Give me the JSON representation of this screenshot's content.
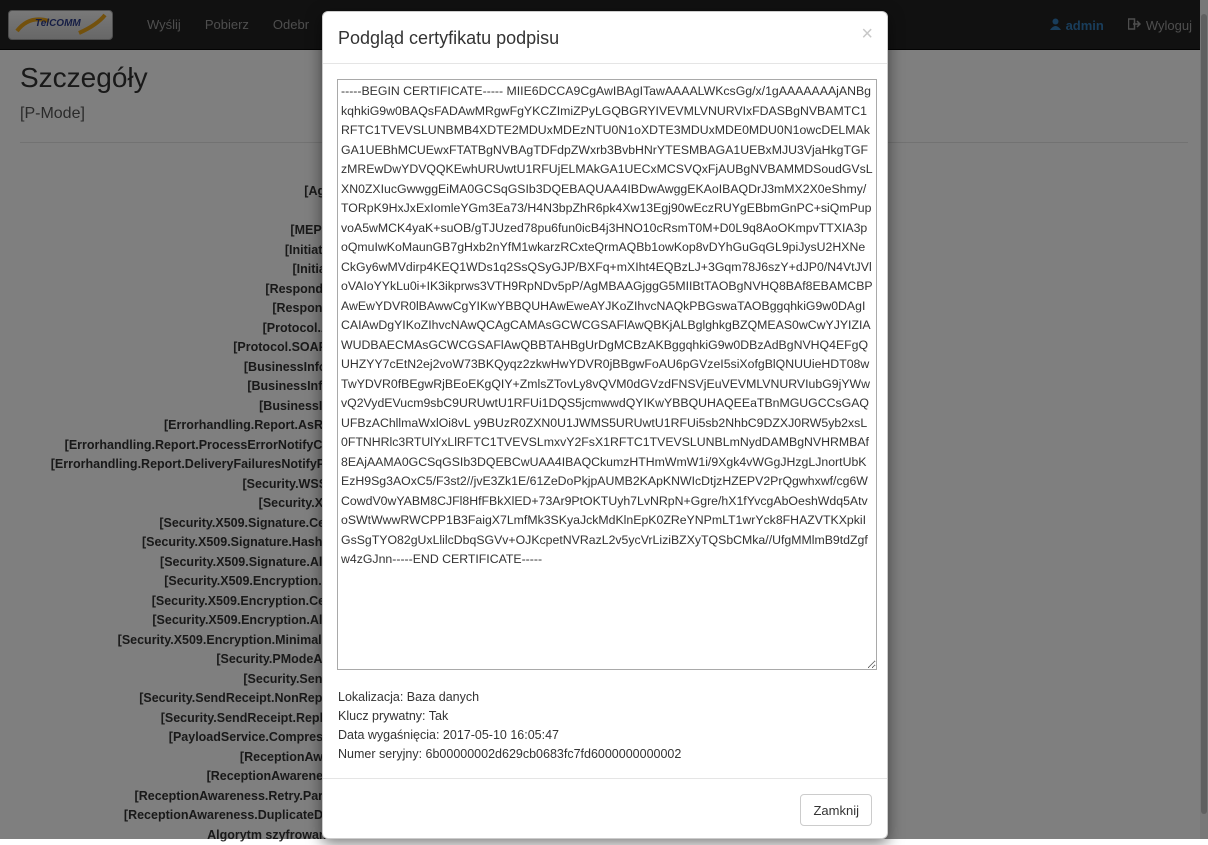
{
  "navbar": {
    "logo_text": "TelCOMM",
    "items": [
      "Wyślij",
      "Pobierz",
      "Odebr"
    ],
    "user": "admin",
    "logout": "Wyloguj"
  },
  "page": {
    "title": "Szczegóły",
    "subtitle": "[P-Mode]",
    "params": [
      "[Agr",
      "",
      "[MEPE",
      "[Initiato",
      "[Initiat",
      "[Responde",
      "[Respond",
      "[Protocol.A",
      "[Protocol.SOAP'",
      "[BusinessInfo.",
      "[BusinessInfo",
      "[BusinessIn",
      "[Errorhandling.Report.AsRe",
      "[Errorhandling.Report.ProcessErrorNotifyCo",
      "[Errorhandling.Report.DeliveryFailuresNotifyPr",
      "[Security.WSS'",
      "[Security.X5",
      "[Security.X509.Signature.Cer",
      "[Security.X509.Signature.HashF",
      "[Security.X509.Signature.Alg",
      "[Security.X509.Encryption.E",
      "[Security.X509.Encryption.Cer",
      "[Security.X509.Encryption.Alg",
      "[Security.X509.Encryption.MinimalS",
      "[Security.PModeAu",
      "[Security.Send",
      "[Security.SendReceipt.NonRepu",
      "[Security.SendReceipt.Reply",
      "[PayloadService.Compress",
      "[ReceptionAwa",
      "[ReceptionAwarenes",
      "[ReceptionAwareness.Retry.Para",
      "[ReceptionAwareness.DuplicateDe",
      "Algorytm szyfrowani"
    ]
  },
  "modal": {
    "title": "Podgląd certyfikatu podpisu",
    "close_symbol": "×",
    "certificate": "-----BEGIN CERTIFICATE----- MIIE6DCCA9CgAwIBAgITawAAAALWKcsGg/x/1gAAAAAAAjANBgkqhkiG9w0BAQsFADAwMRgwFgYKCZImiZPyLGQBGRYIVEVMLVNURVIxFDASBgNVBAMTC1RFTC1TVEVSLUNBMB4XDTE2MDUxMDEzNTU0N1oXDTE3MDUxMDE0MDU0N1owcDELMAkGA1UEBhMCUEwxFTATBgNVBAgTDFdpZWxrb3BvbHNrYTESMBAGA1UEBxMJU3VjaHkgTGFzMREwDwYDVQQKEwhURUwtU1RFUjELMAkGA1UECxMCSVQxFjAUBgNVBAMMDSoudGVsLXN0ZXIucGwwggEiMA0GCSqGSIb3DQEBAQUAA4IBDwAwggEKAoIBAQDrJ3mMX2X0eShmy/TORpK9HxJxExIomleYGm3Ea73/H4N3bpZhR6pk4Xw13Egj90wEczRUYgEBbmGnPC+siQmPupvoA5wMCK4yaK+suOB/gTJUzed78pu6fun0icB4j3HNO10cRsmT0M+D0L9q8AoOKmpvTTXIA3poQmuIwKoMaunGB7gHxb2nYfM1wkarzRCxteQrmAQBb1owKop8vDYhGuGqGL9piJysU2HXNeCkGy6wMVdirp4KEQ1WDs1q2SsQSyGJP/BXFq+mXIht4EQBzLJ+3Gqm78J6szY+dJP0/N4VtJVloVAIoYYkLu0i+IK3ikprws3VTH9RpNDv5pP/AgMBAAGjggG5MIIBtTAOBgNVHQ8BAf8EBAMCBPAwEwYDVR0lBAwwCgYIKwYBBQUHAwEweAYJKoZIhvcNAQkPBGswaTAOBggqhkiG9w0DAgICAIAwDgYIKoZIhvcNAwQCAgCAMAsGCWCGSAFlAwQBKjALBglghkgBZQMEAS0wCwYJYIZIAWUDBAECMAsGCWCGSAFlAwQBBTAHBgUrDgMCBzAKBggqhkiG9w0DBzAdBgNVHQ4EFgQUHZYY7cEtN2ej2voW73BKQyqz2zkwHwYDVR0jBBgwFoAU6pGVzeI5siXofgBlQNUUieHDT08wTwYDVR0fBEgwRjBEoEKgQIY+ZmlsZTovLy8vQVM0dGVzdFNSVjEuVEVMLVNURVIubG9jYWwvQ2VydEVucm9sbC9URUwtU1RFUi1DQS5jcmwwdQYIKwYBBQUHAQEEaTBnMGUGCCsGAQUFBzAChllmaWxlOi8vL y9BUzR0ZXN0U1JWMS5URUwtU1RFUi5sb2NhbC9DZXJ0RW5yb2xsL0FTNHRlc3RTUlYxLlRFTC1TVEVSLmxvY2FsX1RFTC1TVEVSLUNBLmNydDAMBgNVHRMBAf8EAjAAMA0GCSqGSIb3DQEBCwUAA4IBAQCkumzHTHmWmW1i/9Xgk4vWGgJHzgLJnortUbKEzH9Sg3AOxC5/F3st2//jvE3Zk1E/61ZeDoPkjpAUMB2KApKNWIcDtjzHZEPV2PrQgwhxwf/cg6WCowdV0wYABM8CJFl8HfFBkXlED+73Ar9PtOKTUyh7LvNRpN+Ggre/hX1fYvcgAbOeshWdq5AtvoSWtWwwRWCPP1B3FaigX7LmfMk3SKyaJckMdKlnEpK0ZReYNPmLT1wrYck8FHAZVTKXpkiIGsSgTYO82gUxLlilcDbqSGVv+OJKcpetNVRazL2v5ycVrLiziBZXyTQSbCMka//UfgMMlmB9tdZgfw4zGJnn-----END CERTIFICATE-----",
    "info": {
      "location": "Lokalizacja: Baza danych",
      "private_key": "Klucz prywatny: Tak",
      "expiry": "Data wygaśnięcia: 2017-05-10 16:05:47",
      "serial": "Numer seryjny: 6b00000002d629cb0683fc7fd6000000000002"
    },
    "close_button": "Zamknij"
  }
}
